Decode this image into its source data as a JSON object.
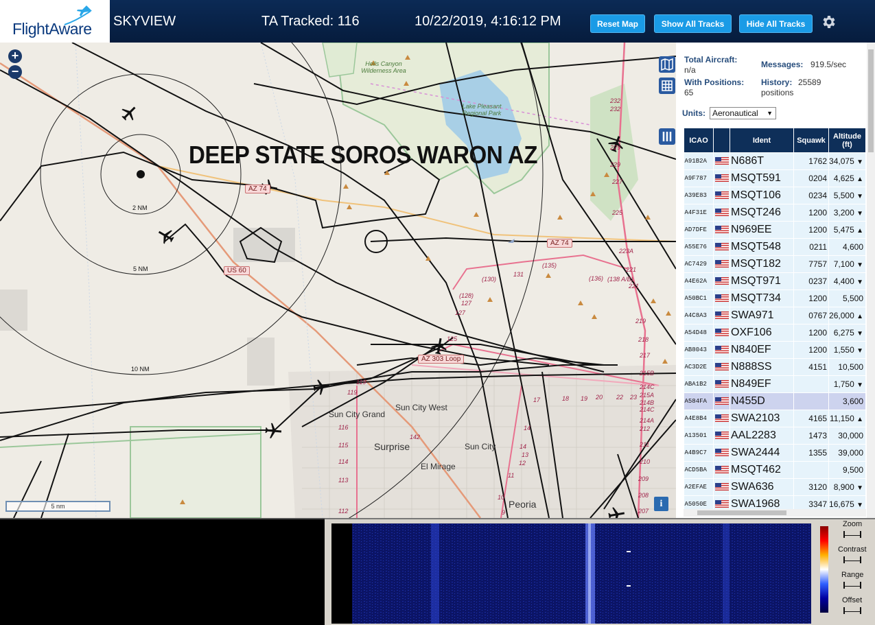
{
  "header": {
    "logo_text": "FlightAware",
    "app_name": "SKYVIEW",
    "tracked": "TA Tracked: 116",
    "datetime": "10/22/2019, 4:16:12 PM",
    "buttons": {
      "reset_map": "Reset Map",
      "show_all": "Show All Tracks",
      "hide_all": "Hide All Tracks"
    }
  },
  "map": {
    "overlay_text": "DEEP STATE SOROS WARON AZ",
    "scale_label": "5 nm",
    "zoom_in": "+",
    "zoom_out": "−",
    "info_label": "i",
    "rings": [
      "2 NM",
      "5 NM",
      "10 NM"
    ],
    "places": {
      "hells_canyon": "Hells Canyon Wilderness Area",
      "park": "Lake Pleasant Regional Park",
      "sun_city_grand": "Sun City Grand",
      "sun_city_west": "Sun City West",
      "surprise": "Surprise",
      "sun_city": "Sun City",
      "el_mirage": "El Mirage",
      "peoria": "Peoria"
    },
    "routes": {
      "az74a": "AZ 74",
      "az74b": "AZ 74",
      "us60": "US 60",
      "az303": "AZ 303 Loop"
    },
    "road_numbers": [
      "232",
      "232",
      "229",
      "229",
      "227",
      "225",
      "223A",
      "221",
      "221",
      "219",
      "218",
      "217",
      "215B",
      "214C",
      "215A",
      "214B",
      "214C",
      "214A",
      "212",
      "211",
      "210",
      "209",
      "208",
      "207",
      "(130)",
      "(128)",
      "127",
      "127",
      "125",
      "131",
      "(135)",
      "(136)",
      "(138 A/B)",
      "119",
      "119",
      "116",
      "115",
      "114",
      "113",
      "112",
      "142",
      "17",
      "18",
      "19",
      "20",
      "22",
      "23",
      "14",
      "14",
      "13",
      "12",
      "11",
      "10",
      "9"
    ]
  },
  "sidebar": {
    "total_aircraft_label": "Total Aircraft:",
    "total_aircraft_value": "n/a",
    "with_positions_label": "With Positions:",
    "with_positions_value": "65",
    "messages_label": "Messages:",
    "messages_value": "919.5/sec",
    "history_label": "History:",
    "history_value": "25589",
    "history_unit": "positions",
    "units_label": "Units:",
    "units_value": "Aeronautical",
    "table": {
      "headers": [
        "ICAO",
        "",
        "Ident",
        "Squawk",
        "Altitude (ft)"
      ],
      "rows": [
        {
          "icao": "A91B2A",
          "ident": "N686T",
          "squawk": "1762",
          "alt": "34,075",
          "trend": "▼"
        },
        {
          "icao": "A9F787",
          "ident": "MSQT591",
          "squawk": "0204",
          "alt": "4,625",
          "trend": "▲"
        },
        {
          "icao": "A39E83",
          "ident": "MSQT106",
          "squawk": "0234",
          "alt": "5,500",
          "trend": "▼"
        },
        {
          "icao": "A4F31E",
          "ident": "MSQT246",
          "squawk": "1200",
          "alt": "3,200",
          "trend": "▼"
        },
        {
          "icao": "AD7DFE",
          "ident": "N969EE",
          "squawk": "1200",
          "alt": "5,475",
          "trend": "▲"
        },
        {
          "icao": "A55E76",
          "ident": "MSQT548",
          "squawk": "0211",
          "alt": "4,600",
          "trend": ""
        },
        {
          "icao": "AC7429",
          "ident": "MSQT182",
          "squawk": "7757",
          "alt": "7,100",
          "trend": "▼"
        },
        {
          "icao": "A4E62A",
          "ident": "MSQT971",
          "squawk": "0237",
          "alt": "4,400",
          "trend": "▼"
        },
        {
          "icao": "A50BC1",
          "ident": "MSQT734",
          "squawk": "1200",
          "alt": "5,500",
          "trend": ""
        },
        {
          "icao": "A4C8A3",
          "ident": "SWA971",
          "squawk": "0767",
          "alt": "26,000",
          "trend": "▲"
        },
        {
          "icao": "A54D48",
          "ident": "OXF106",
          "squawk": "1200",
          "alt": "6,275",
          "trend": "▼"
        },
        {
          "icao": "AB8043",
          "ident": "N840EF",
          "squawk": "1200",
          "alt": "1,550",
          "trend": "▼"
        },
        {
          "icao": "AC3D2E",
          "ident": "N888SS",
          "squawk": "4151",
          "alt": "10,500",
          "trend": ""
        },
        {
          "icao": "ABA1B2",
          "ident": "N849EF",
          "squawk": "",
          "alt": "1,750",
          "trend": "▼"
        },
        {
          "icao": "A584FA",
          "ident": "N455D",
          "squawk": "",
          "alt": "3,600",
          "trend": ""
        },
        {
          "icao": "A4E8B4",
          "ident": "SWA2103",
          "squawk": "4165",
          "alt": "11,150",
          "trend": "▲"
        },
        {
          "icao": "A13501",
          "ident": "AAL2283",
          "squawk": "1473",
          "alt": "30,000",
          "trend": ""
        },
        {
          "icao": "A4B9C7",
          "ident": "SWA2444",
          "squawk": "1355",
          "alt": "39,000",
          "trend": ""
        },
        {
          "icao": "ACD5BA",
          "ident": "MSQT462",
          "squawk": "",
          "alt": "9,500",
          "trend": ""
        },
        {
          "icao": "A2EFAE",
          "ident": "SWA636",
          "squawk": "3120",
          "alt": "8,900",
          "trend": "▼"
        },
        {
          "icao": "A5050E",
          "ident": "SWA1968",
          "squawk": "3347",
          "alt": "16,675",
          "trend": "▼"
        }
      ],
      "selected_index": 14
    }
  },
  "spectrum": {
    "controls": [
      "Zoom",
      "Contrast",
      "Range",
      "Offset"
    ]
  },
  "colors": {
    "header_bg": "#0b2a55",
    "button_bg": "#1a9be6",
    "table_header": "#0e2f59",
    "row_bg": "#e6f3fb",
    "row_selected": "#cdd3ee"
  }
}
